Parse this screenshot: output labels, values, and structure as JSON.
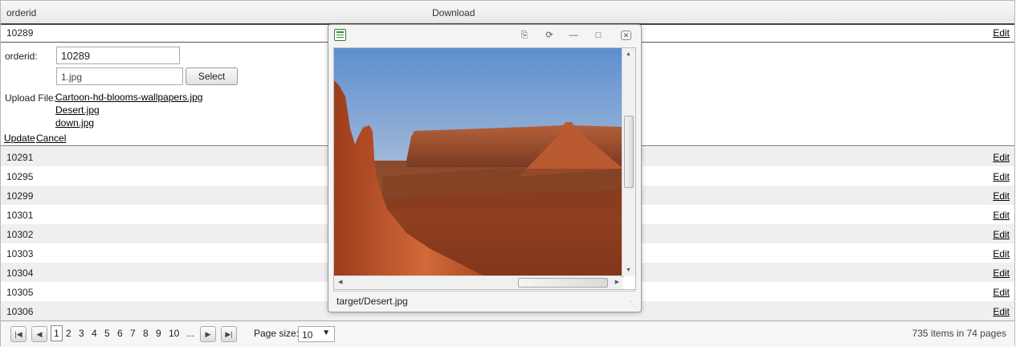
{
  "grid": {
    "columns": [
      "orderid",
      "Download"
    ],
    "first_row": {
      "id": "10289",
      "edit": "Edit"
    },
    "rows": [
      {
        "id": "10291",
        "edit": "Edit"
      },
      {
        "id": "10295",
        "edit": "Edit"
      },
      {
        "id": "10299",
        "edit": "Edit"
      },
      {
        "id": "10301",
        "edit": "Edit"
      },
      {
        "id": "10302",
        "edit": "Edit"
      },
      {
        "id": "10303",
        "edit": "Edit"
      },
      {
        "id": "10304",
        "edit": "Edit"
      },
      {
        "id": "10305",
        "edit": "Edit"
      },
      {
        "id": "10306",
        "edit": "Edit"
      }
    ]
  },
  "edit_form": {
    "orderid_label": "orderid:",
    "orderid_value": "10289",
    "file_value": "1.jpg",
    "select_label": "Select",
    "upload_label": "Upload File:",
    "files": [
      "Cartoon-hd-blooms-wallpapers.jpg",
      "Desert.jpg",
      "down.jpg"
    ],
    "update_label": "Update",
    "cancel_label": "Cancel"
  },
  "pager": {
    "pages": [
      "1",
      "2",
      "3",
      "4",
      "5",
      "6",
      "7",
      "8",
      "9",
      "10",
      "..."
    ],
    "current_page": "1",
    "page_size_label": "Page size:",
    "page_size_value": "10",
    "summary": "735 items in 74 pages"
  },
  "preview_window": {
    "status_text": "target/Desert.jpg",
    "image_icon": "desert-landscape-image"
  }
}
